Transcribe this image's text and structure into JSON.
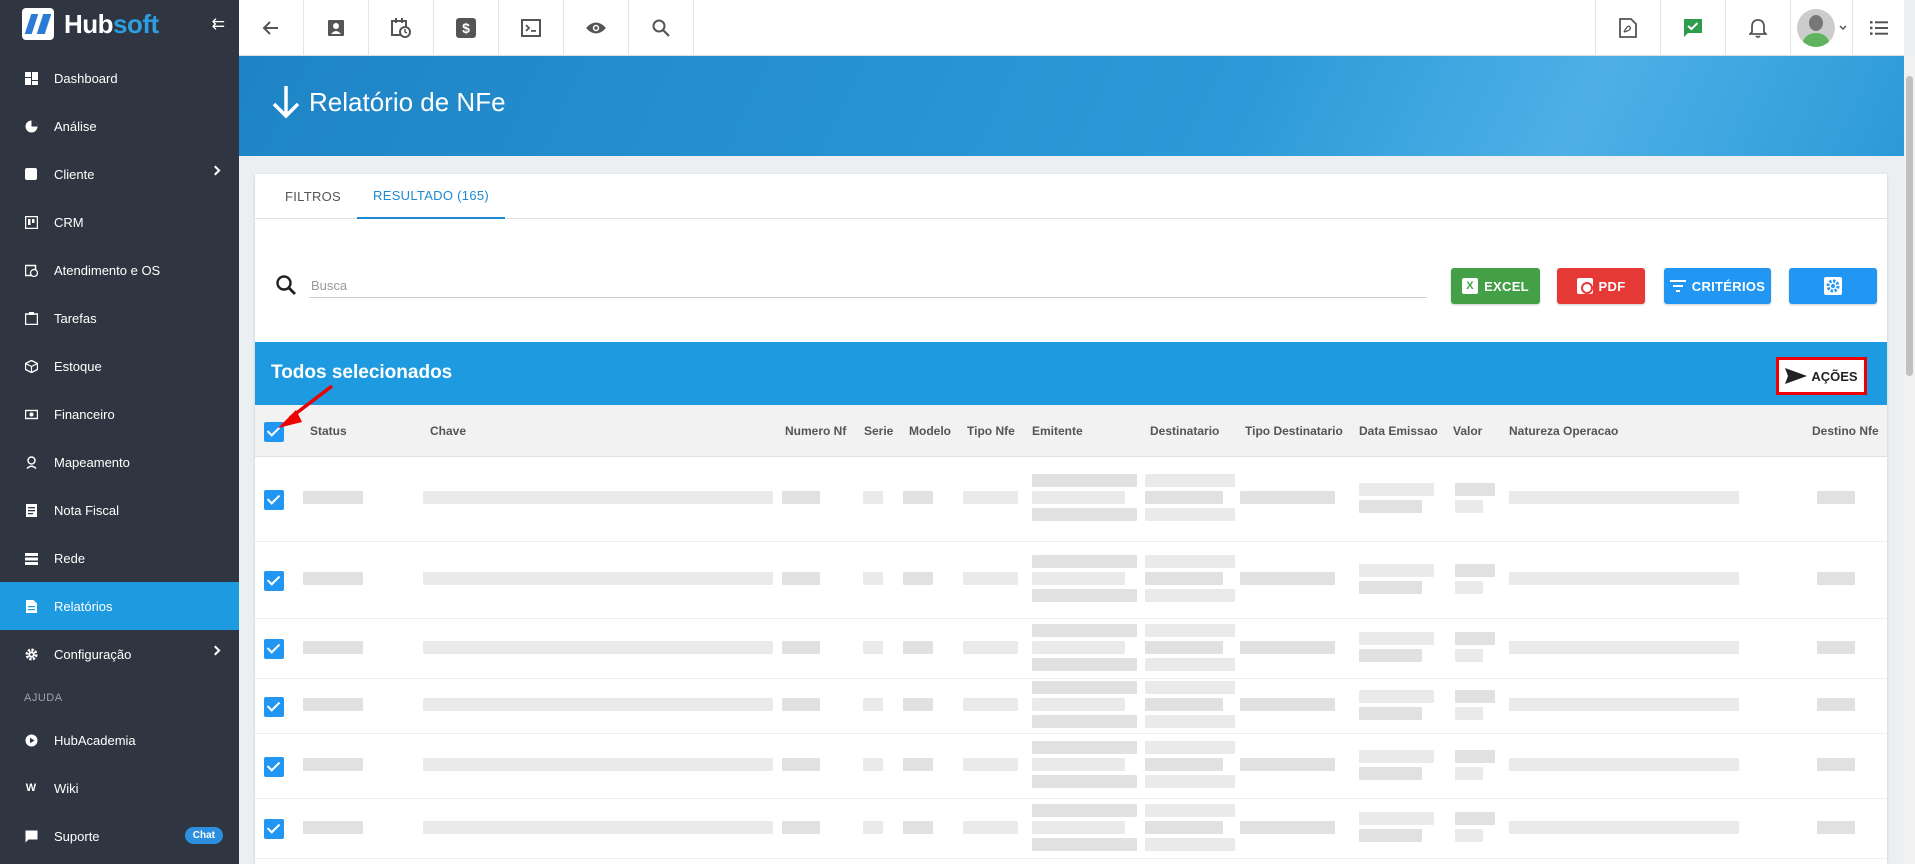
{
  "brand": {
    "hub": "Hub",
    "soft": "soft"
  },
  "sidebar": {
    "items": [
      {
        "label": "Dashboard",
        "icon": "dashboard-icon"
      },
      {
        "label": "Análise",
        "icon": "pie-chart-icon"
      },
      {
        "label": "Cliente",
        "icon": "contact-icon",
        "has_submenu": true
      },
      {
        "label": "CRM",
        "icon": "crm-board-icon"
      },
      {
        "label": "Atendimento e OS",
        "icon": "calendar-clock-icon"
      },
      {
        "label": "Tarefas",
        "icon": "tasks-icon"
      },
      {
        "label": "Estoque",
        "icon": "box-icon"
      },
      {
        "label": "Financeiro",
        "icon": "money-icon"
      },
      {
        "label": "Mapeamento",
        "icon": "map-pin-icon"
      },
      {
        "label": "Nota Fiscal",
        "icon": "invoice-icon"
      },
      {
        "label": "Rede",
        "icon": "network-icon"
      },
      {
        "label": "Relatórios",
        "icon": "report-icon",
        "active": true
      },
      {
        "label": "Configuração",
        "icon": "gear-icon",
        "has_submenu": true
      }
    ],
    "help_section": "AJUDA",
    "help_items": [
      {
        "label": "HubAcademia",
        "icon": "play-icon"
      },
      {
        "label": "Wiki",
        "icon": "wiki-icon"
      },
      {
        "label": "Suporte",
        "icon": "support-icon",
        "badge": "Chat"
      }
    ]
  },
  "page": {
    "title": "Relatório de NFe"
  },
  "tabs": [
    {
      "label": "FILTROS",
      "active": false
    },
    {
      "label": "RESULTADO (165)",
      "active": true
    }
  ],
  "search": {
    "placeholder": "Busca",
    "value": ""
  },
  "buttons": {
    "excel": "EXCEL",
    "pdf": "PDF",
    "criterios": "CRITÉRIOS"
  },
  "selection": {
    "title": "Todos selecionados",
    "actions": "AÇÕES"
  },
  "columns": [
    "Status",
    "Chave",
    "Numero Nf",
    "Serie",
    "Modelo",
    "Tipo Nfe",
    "Emitente",
    "Destinatario",
    "Tipo Destinatario",
    "Data Emissao",
    "Valor",
    "Natureza Operacao",
    "Destino Nfe"
  ],
  "colors": {
    "sidebar": "#2f3541",
    "accent": "#1e9be0",
    "excel": "#43a047",
    "pdf": "#e53935",
    "criterios": "#2196f3",
    "highlight": "#e00000"
  }
}
